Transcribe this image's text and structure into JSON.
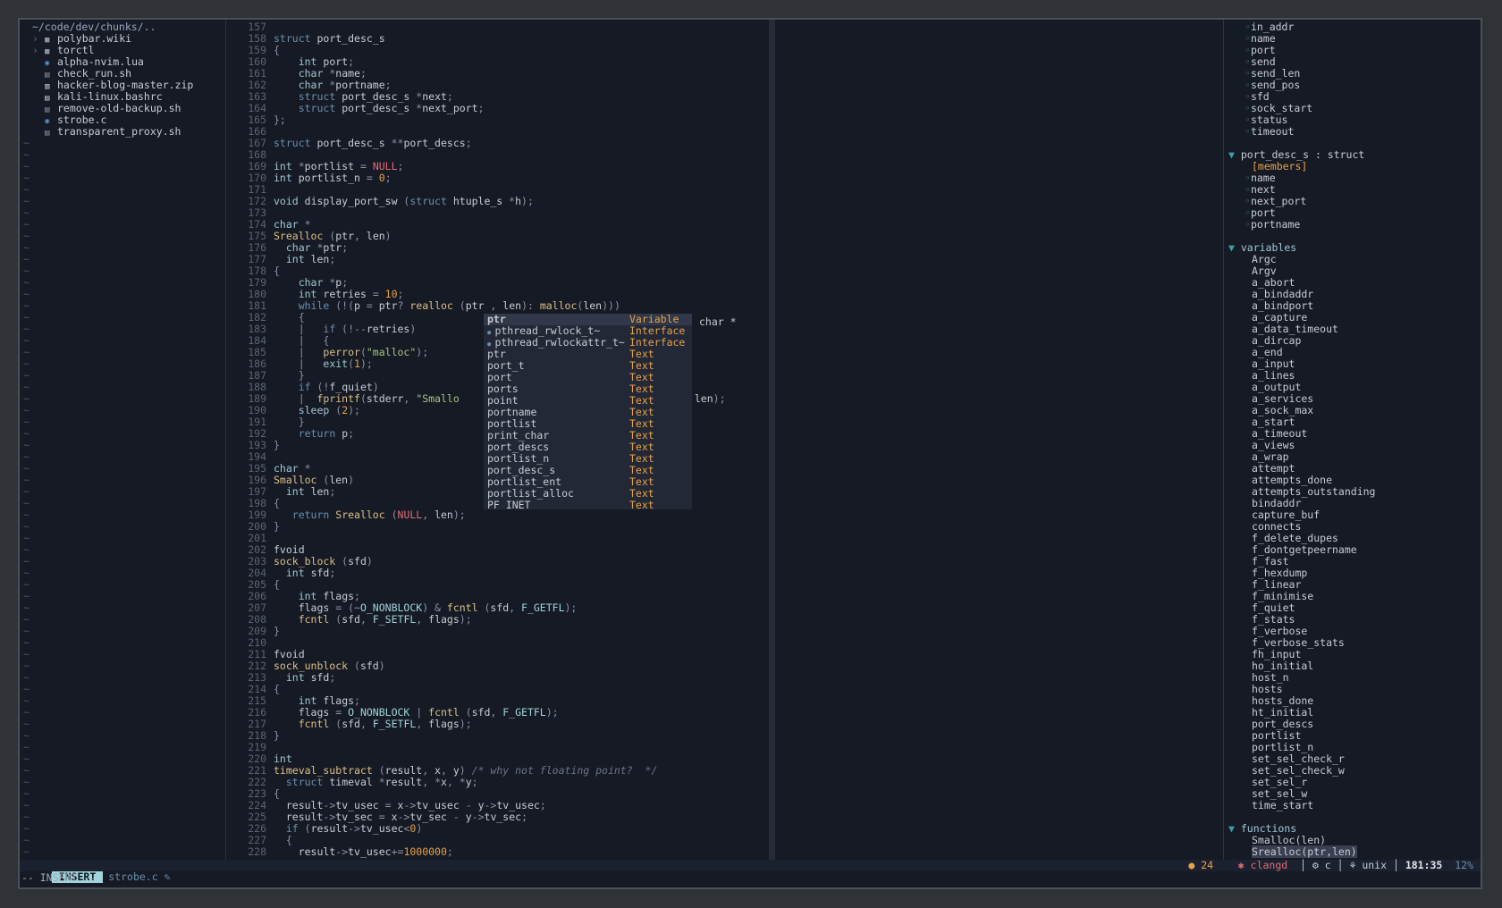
{
  "tree": {
    "root": "~/code/dev/chunks/..",
    "items": [
      {
        "icon": "folder",
        "label": "polybar.wiki",
        "caret": "›"
      },
      {
        "icon": "folder",
        "label": "torctl",
        "caret": "›"
      },
      {
        "icon": "lua",
        "label": "alpha-nvim.lua",
        "caret": ""
      },
      {
        "icon": "shell",
        "label": "check_run.sh",
        "caret": ""
      },
      {
        "icon": "archive",
        "label": "hacker-blog-master.zip",
        "caret": ""
      },
      {
        "icon": "file",
        "label": "kali-linux.bashrc",
        "caret": ""
      },
      {
        "icon": "shell",
        "label": "remove-old-backup.sh",
        "caret": ""
      },
      {
        "icon": "c",
        "label": "strobe.c",
        "caret": ""
      },
      {
        "icon": "shell",
        "label": "transparent_proxy.sh",
        "caret": ""
      }
    ],
    "empty_marker": "~"
  },
  "editor": {
    "lines": [
      {
        "n": "157",
        "t": ""
      },
      {
        "n": "158",
        "t": "struct port_desc_s"
      },
      {
        "n": "159",
        "t": "{"
      },
      {
        "n": "160",
        "t": "    int port;"
      },
      {
        "n": "161",
        "t": "    char *name;"
      },
      {
        "n": "162",
        "t": "    char *portname;"
      },
      {
        "n": "163",
        "t": "    struct port_desc_s *next;"
      },
      {
        "n": "164",
        "t": "    struct port_desc_s *next_port;"
      },
      {
        "n": "165",
        "t": "};"
      },
      {
        "n": "166",
        "t": ""
      },
      {
        "n": "167",
        "t": "struct port_desc_s **port_descs;"
      },
      {
        "n": "168",
        "t": ""
      },
      {
        "n": "169",
        "t": "int *portlist = NULL;"
      },
      {
        "n": "170",
        "t": "int portlist_n = 0;"
      },
      {
        "n": "171",
        "t": ""
      },
      {
        "n": "172",
        "t": "void display_port_sw (struct htuple_s *h);"
      },
      {
        "n": "173",
        "t": ""
      },
      {
        "n": "174",
        "t": "char *"
      },
      {
        "n": "175",
        "t": "Srealloc (ptr, len)"
      },
      {
        "n": "176",
        "t": "  char *ptr;"
      },
      {
        "n": "177",
        "t": "  int len;"
      },
      {
        "n": "178",
        "t": "{"
      },
      {
        "n": "179",
        "t": "    char *p;"
      },
      {
        "n": "180",
        "t": "    int retries = 10;"
      },
      {
        "n": "181",
        "t": "    while (!(p = ptr? realloc (ptr , len): malloc(len)))"
      },
      {
        "n": "182",
        "t": "    {"
      },
      {
        "n": "183",
        "t": "    |   if (!--retries)"
      },
      {
        "n": "184",
        "t": "    |   {"
      },
      {
        "n": "185",
        "t": "    |   perror(\"malloc\");"
      },
      {
        "n": "186",
        "t": "    |   exit(1);"
      },
      {
        "n": "187",
        "t": "    }"
      },
      {
        "n": "188",
        "t": "    if (!f_quiet)"
      },
      {
        "n": "189",
        "t": "    |  fprintf(stderr, \"Smallo                           eeping\\n\", len);"
      },
      {
        "n": "190",
        "t": "    sleep (2);"
      },
      {
        "n": "191",
        "t": "    }"
      },
      {
        "n": "192",
        "t": "    return p;"
      },
      {
        "n": "193",
        "t": "}"
      },
      {
        "n": "194",
        "t": ""
      },
      {
        "n": "195",
        "t": "char *"
      },
      {
        "n": "196",
        "t": "Smalloc (len)"
      },
      {
        "n": "197",
        "t": "  int len;"
      },
      {
        "n": "198",
        "t": "{"
      },
      {
        "n": "199",
        "t": "   return Srealloc (NULL, len);"
      },
      {
        "n": "200",
        "t": "}"
      },
      {
        "n": "201",
        "t": ""
      },
      {
        "n": "202",
        "t": "fvoid"
      },
      {
        "n": "203",
        "t": "sock_block (sfd)"
      },
      {
        "n": "204",
        "t": "  int sfd;"
      },
      {
        "n": "205",
        "t": "{"
      },
      {
        "n": "206",
        "t": "    int flags;"
      },
      {
        "n": "207",
        "t": "    flags = (~O_NONBLOCK) & fcntl (sfd, F_GETFL);"
      },
      {
        "n": "208",
        "t": "    fcntl (sfd, F_SETFL, flags);"
      },
      {
        "n": "209",
        "t": "}"
      },
      {
        "n": "210",
        "t": ""
      },
      {
        "n": "211",
        "t": "fvoid"
      },
      {
        "n": "212",
        "t": "sock_unblock (sfd)"
      },
      {
        "n": "213",
        "t": "  int sfd;"
      },
      {
        "n": "214",
        "t": "{"
      },
      {
        "n": "215",
        "t": "    int flags;"
      },
      {
        "n": "216",
        "t": "    flags = O_NONBLOCK | fcntl (sfd, F_GETFL);"
      },
      {
        "n": "217",
        "t": "    fcntl (sfd, F_SETFL, flags);"
      },
      {
        "n": "218",
        "t": "}"
      },
      {
        "n": "219",
        "t": ""
      },
      {
        "n": "220",
        "t": "int"
      },
      {
        "n": "221",
        "t": "timeval_subtract (result, x, y) /* why not floating point?  */"
      },
      {
        "n": "222",
        "t": "  struct timeval *result, *x, *y;"
      },
      {
        "n": "223",
        "t": "{"
      },
      {
        "n": "224",
        "t": "  result->tv_usec = x->tv_usec - y->tv_usec;"
      },
      {
        "n": "225",
        "t": "  result->tv_sec = x->tv_sec - y->tv_sec;"
      },
      {
        "n": "226",
        "t": "  if (result->tv_usec<0)"
      },
      {
        "n": "227",
        "t": "  {"
      },
      {
        "n": "228",
        "t": "    result->tv_usec+=1000000;"
      }
    ]
  },
  "completion": {
    "signature": "char *",
    "items": [
      {
        "label": "ptr",
        "kind": "Variable",
        "bullet": false
      },
      {
        "label": "pthread_rwlock_t~",
        "kind": "Interface",
        "bullet": true
      },
      {
        "label": "pthread_rwlockattr_t~",
        "kind": "Interface",
        "bullet": true
      },
      {
        "label": "ptr",
        "kind": "Text",
        "bullet": false
      },
      {
        "label": "port_t",
        "kind": "Text",
        "bullet": false
      },
      {
        "label": "port",
        "kind": "Text",
        "bullet": false
      },
      {
        "label": "ports",
        "kind": "Text",
        "bullet": false
      },
      {
        "label": "point",
        "kind": "Text",
        "bullet": false
      },
      {
        "label": "portname",
        "kind": "Text",
        "bullet": false
      },
      {
        "label": "portlist",
        "kind": "Text",
        "bullet": false
      },
      {
        "label": "print_char",
        "kind": "Text",
        "bullet": false
      },
      {
        "label": "port_descs",
        "kind": "Text",
        "bullet": false
      },
      {
        "label": "portlist_n",
        "kind": "Text",
        "bullet": false
      },
      {
        "label": "port_desc_s",
        "kind": "Text",
        "bullet": false
      },
      {
        "label": "portlist_ent",
        "kind": "Text",
        "bullet": false
      },
      {
        "label": "portlist_alloc",
        "kind": "Text",
        "bullet": false
      },
      {
        "label": "PF_INET",
        "kind": "Text",
        "bullet": false
      }
    ]
  },
  "outline": {
    "top_members": [
      "in_addr",
      "name",
      "port",
      "send",
      "send_len",
      "send_pos",
      "sfd",
      "sock_start",
      "status",
      "timeout"
    ],
    "struct_header": "port_desc_s : struct",
    "members_label": "[members]",
    "struct_members": [
      "name",
      "next",
      "next_port",
      "port",
      "portname"
    ],
    "variables_header": "variables",
    "variables": [
      "Argc",
      "Argv",
      "a_abort",
      "a_bindaddr",
      "a_bindport",
      "a_capture",
      "a_data_timeout",
      "a_dircap",
      "a_end",
      "a_input",
      "a_lines",
      "a_output",
      "a_services",
      "a_sock_max",
      "a_start",
      "a_timeout",
      "a_views",
      "a_wrap",
      "attempt",
      "attempts_done",
      "attempts_outstanding",
      "bindaddr",
      "capture_buf",
      "connects",
      "f_delete_dupes",
      "f_dontgetpeername",
      "f_fast",
      "f_hexdump",
      "f_linear",
      "f_minimise",
      "f_quiet",
      "f_stats",
      "f_verbose",
      "f_verbose_stats",
      "fh_input",
      "ho_initial",
      "host_n",
      "hosts",
      "hosts_done",
      "ht_initial",
      "port_descs",
      "portlist",
      "portlist_n",
      "set_sel_check_r",
      "set_sel_check_w",
      "set_sel_r",
      "set_sel_w",
      "time_start"
    ],
    "functions_header": "functions",
    "functions": [
      "Smalloc(len)",
      "Srealloc(ptr,len)"
    ]
  },
  "status": {
    "mode": "INSERT",
    "file": "strobe.c",
    "warnings": "24",
    "lsp": "clangd",
    "filetype": "c",
    "format": "unix",
    "position": "181:35",
    "percent": "12%"
  },
  "cmdline": "-- INSERT --",
  "colors": {
    "background": "#161a24",
    "keyword": "#6a8fb0",
    "number": "#e5a24a",
    "string": "#a9c47f",
    "accent": "#9fd4dc",
    "warning": "#e5a24a",
    "error": "#e06c75"
  }
}
